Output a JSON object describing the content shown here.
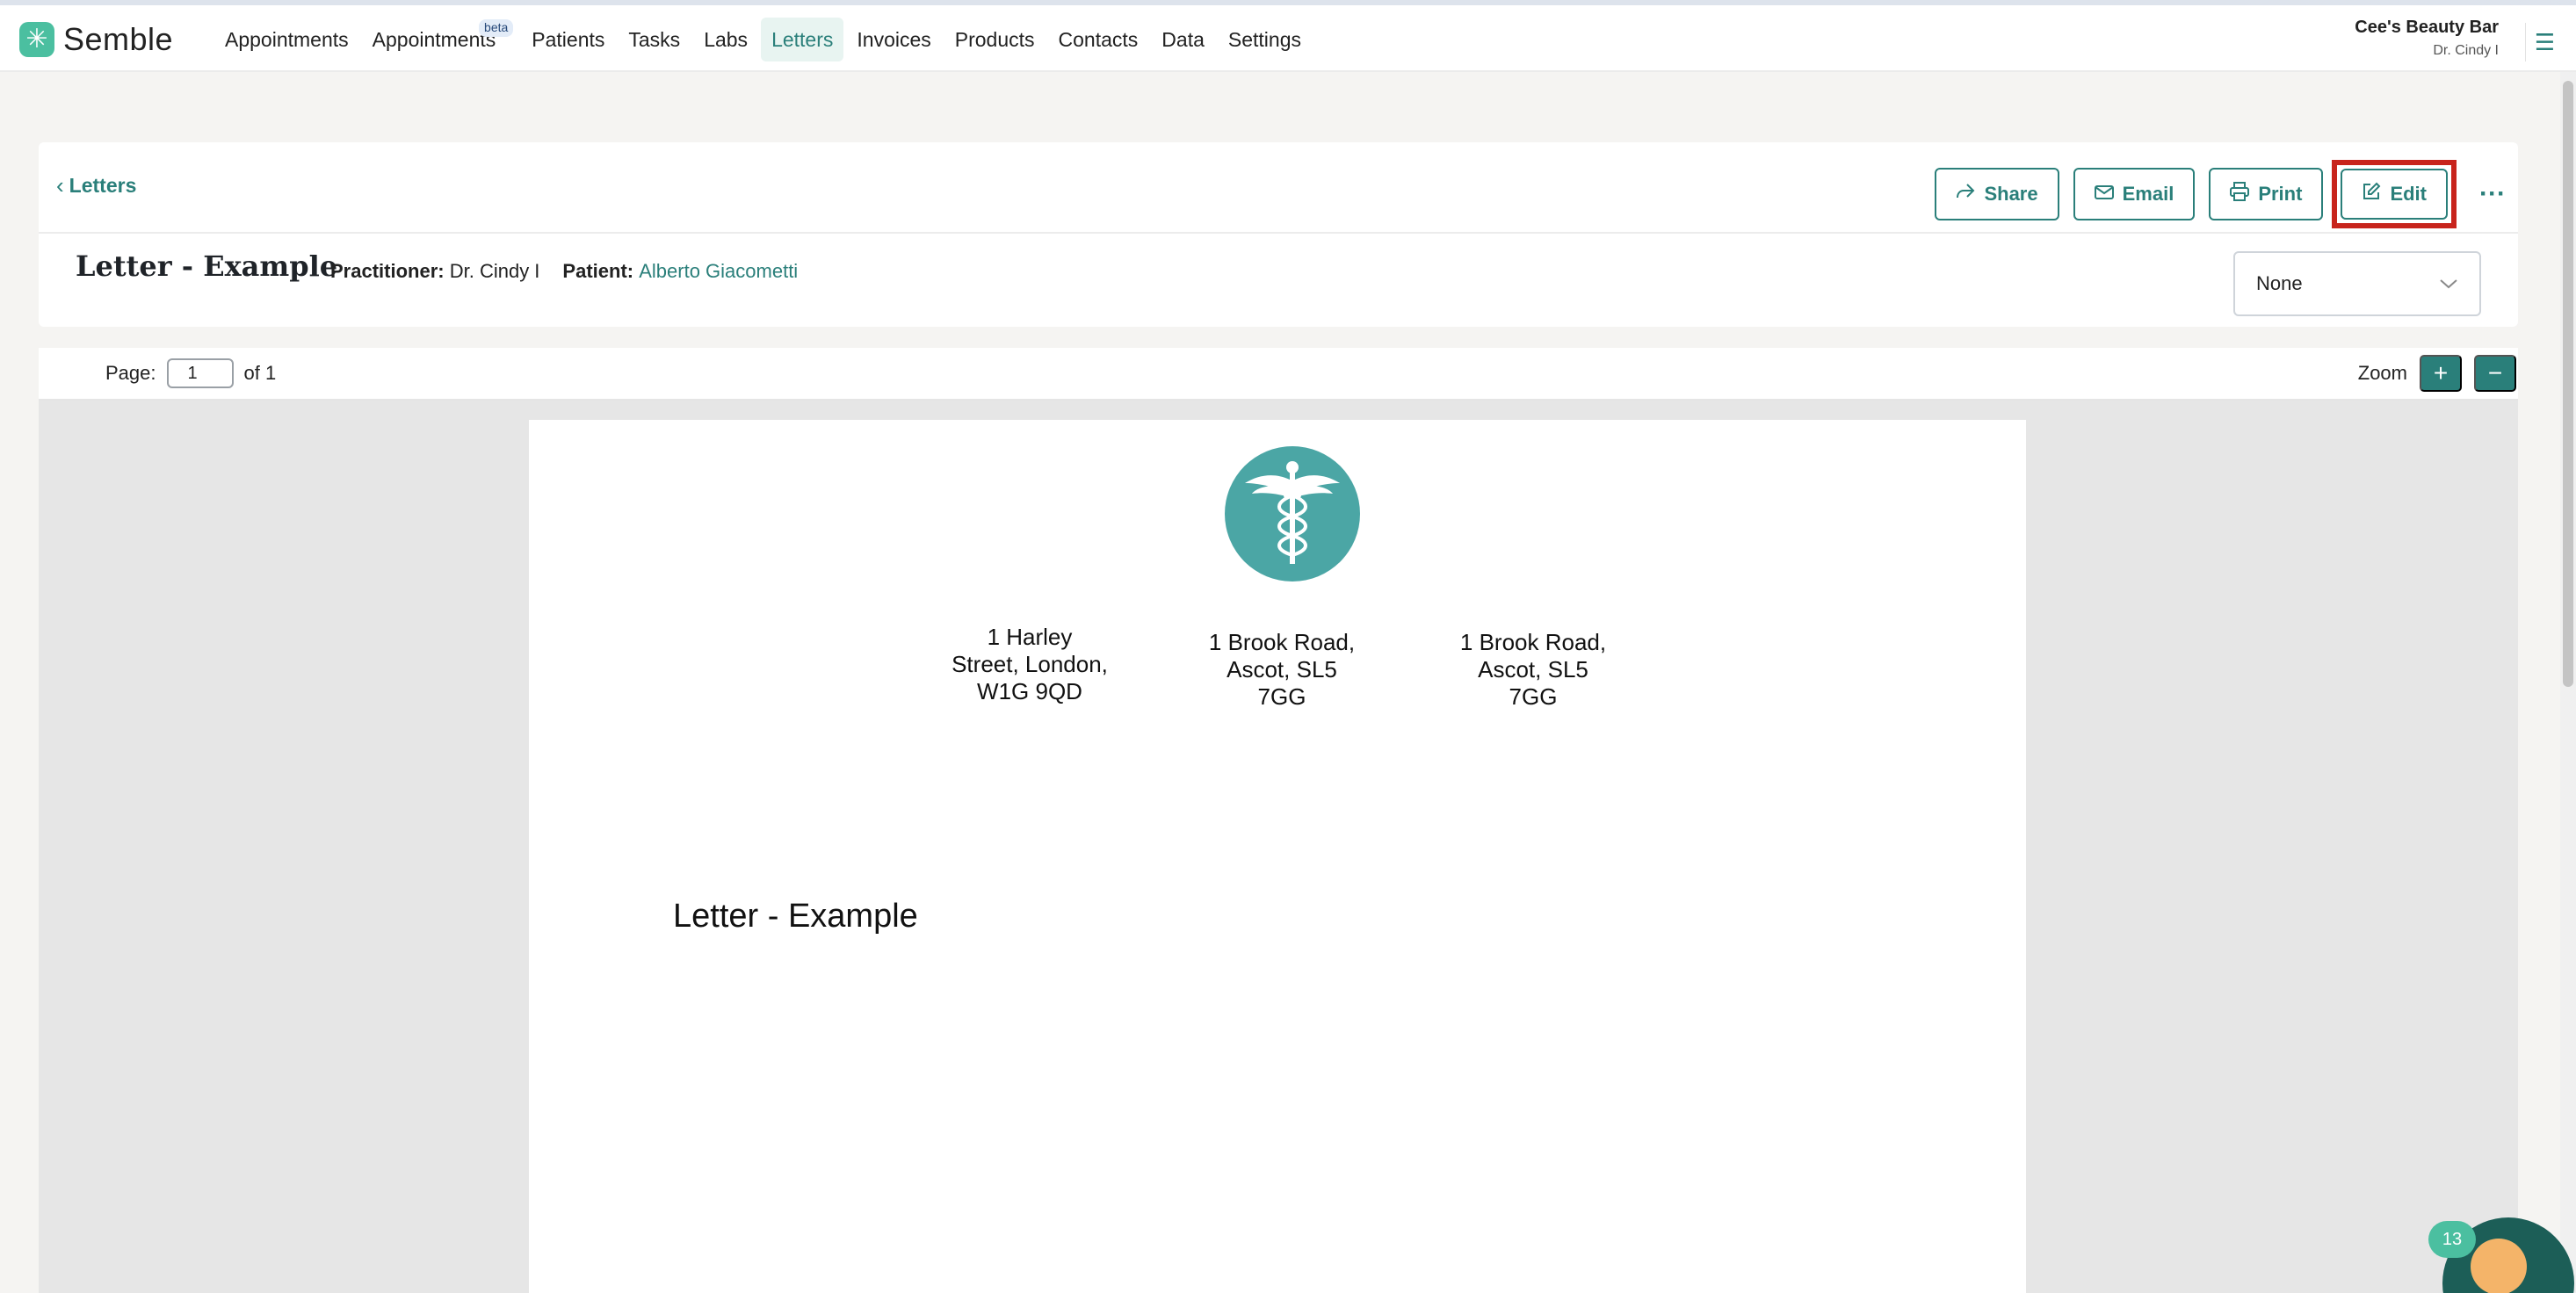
{
  "app": {
    "brand": "Semble",
    "organization": "Cee's Beauty Bar",
    "user": "Dr. Cindy I"
  },
  "nav": {
    "items": [
      {
        "label": "Appointments"
      },
      {
        "label": "Appointments",
        "badge": "beta"
      },
      {
        "label": "Patients"
      },
      {
        "label": "Tasks"
      },
      {
        "label": "Labs"
      },
      {
        "label": "Letters",
        "active": true
      },
      {
        "label": "Invoices"
      },
      {
        "label": "Products"
      },
      {
        "label": "Contacts"
      },
      {
        "label": "Data"
      },
      {
        "label": "Settings"
      }
    ]
  },
  "toolbar": {
    "back_label": "Letters",
    "share_label": "Share",
    "email_label": "Email",
    "print_label": "Print",
    "edit_label": "Edit",
    "more_label": "···"
  },
  "document": {
    "title": "Letter - Example",
    "practitioner_label": "Practitioner:",
    "practitioner": "Dr. Cindy I",
    "patient_label": "Patient:",
    "patient": "Alberto Giacometti",
    "select_value": "None"
  },
  "viewer": {
    "page_label": "Page:",
    "page_value": "1",
    "page_of": "of 1",
    "zoom_label": "Zoom",
    "zoom_in": "+",
    "zoom_out": "−"
  },
  "letter": {
    "addresses": [
      [
        "1 Harley",
        "Street, London,",
        "W1G 9QD"
      ],
      [
        "1 Brook Road,",
        "Ascot, SL5",
        "7GG"
      ],
      [
        "1 Brook Road,",
        "Ascot, SL5",
        "7GG"
      ]
    ],
    "heading": "Letter - Example"
  },
  "chat": {
    "badge_count": "13"
  },
  "colors": {
    "accent": "#2a7f7a",
    "brand": "#4bbfa0",
    "highlight": "#c8241c",
    "emblem": "#4ba6a5"
  }
}
